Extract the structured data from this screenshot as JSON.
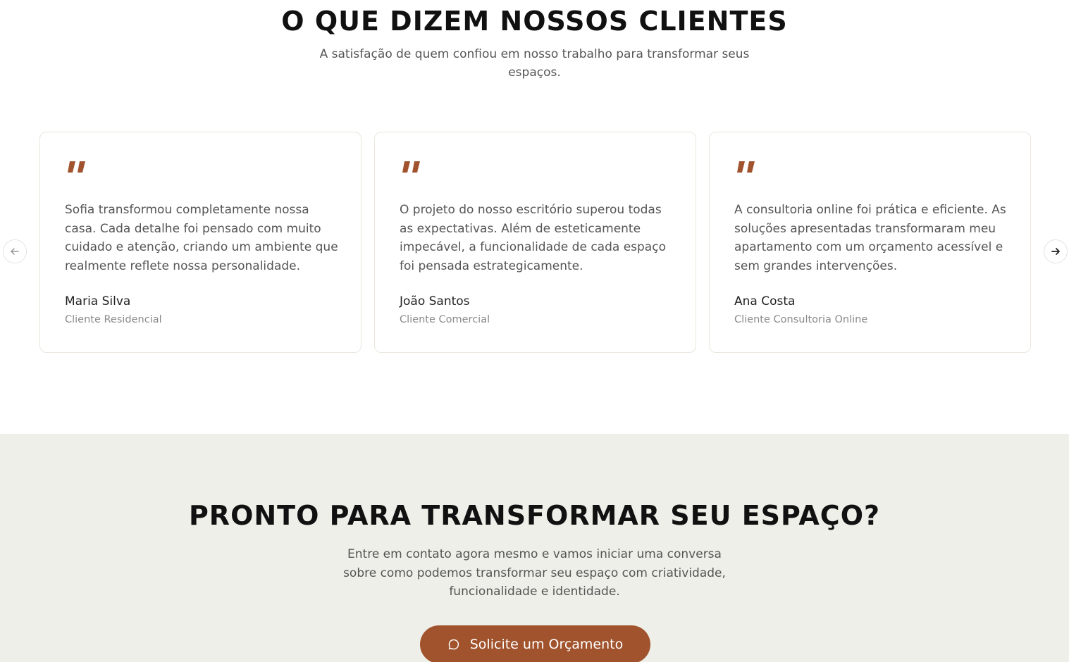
{
  "testimonials": {
    "title": "O QUE DIZEM NOSSOS CLIENTES",
    "subtitle": "A satisfação de quem confiou em nosso trabalho para transformar seus espaços.",
    "accent_color": "#a0532d",
    "items": [
      {
        "text": "Sofia transformou completamente nossa casa. Cada detalhe foi pensado com muito cuidado e atenção, criando um ambiente que realmente reflete nossa personalidade.",
        "name": "Maria Silva",
        "role": "Cliente Residencial"
      },
      {
        "text": "O projeto do nosso escritório superou todas as expectativas. Além de esteticamente impecável, a funcionalidade de cada espaço foi pensada estrategicamente.",
        "name": "João Santos",
        "role": "Cliente Comercial"
      },
      {
        "text": "A consultoria online foi prática e eficiente. As soluções apresentadas transformaram meu apartamento com um orçamento acessível e sem grandes intervenções.",
        "name": "Ana Costa",
        "role": "Cliente Consultoria Online"
      }
    ],
    "icons": {
      "quote": "quote-icon",
      "prev": "arrow-left-icon",
      "next": "arrow-right-icon"
    }
  },
  "cta": {
    "title": "PRONTO PARA TRANSFORMAR SEU ESPAÇO?",
    "text": "Entre em contato agora mesmo e vamos iniciar uma conversa sobre como podemos transformar seu espaço com criatividade, funcionalidade e identidade.",
    "button_label": "Solicite um Orçamento",
    "button_icon": "chat-bubble-icon",
    "background_color": "#eeefe8",
    "button_color": "#a0532d"
  }
}
